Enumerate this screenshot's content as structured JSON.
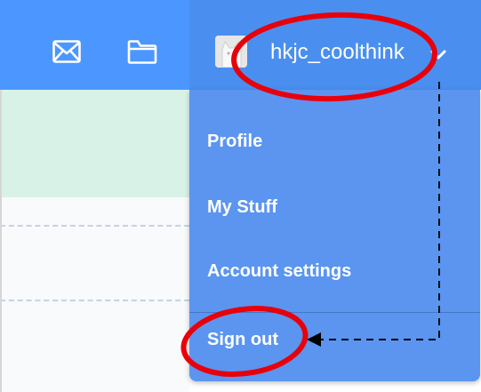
{
  "header": {
    "username": "hkjc_coolthink",
    "icons": {
      "mail": "envelope-icon",
      "folder": "folder-icon",
      "chevron": "chevron-down-icon"
    }
  },
  "dropdown": {
    "items": [
      {
        "label": "Profile"
      },
      {
        "label": "My Stuff"
      },
      {
        "label": "Account settings"
      },
      {
        "label": "Sign out"
      }
    ]
  },
  "colors": {
    "topbar": "#4c97ff",
    "menu": "#5b95f0",
    "annotation": "#e8000b"
  }
}
